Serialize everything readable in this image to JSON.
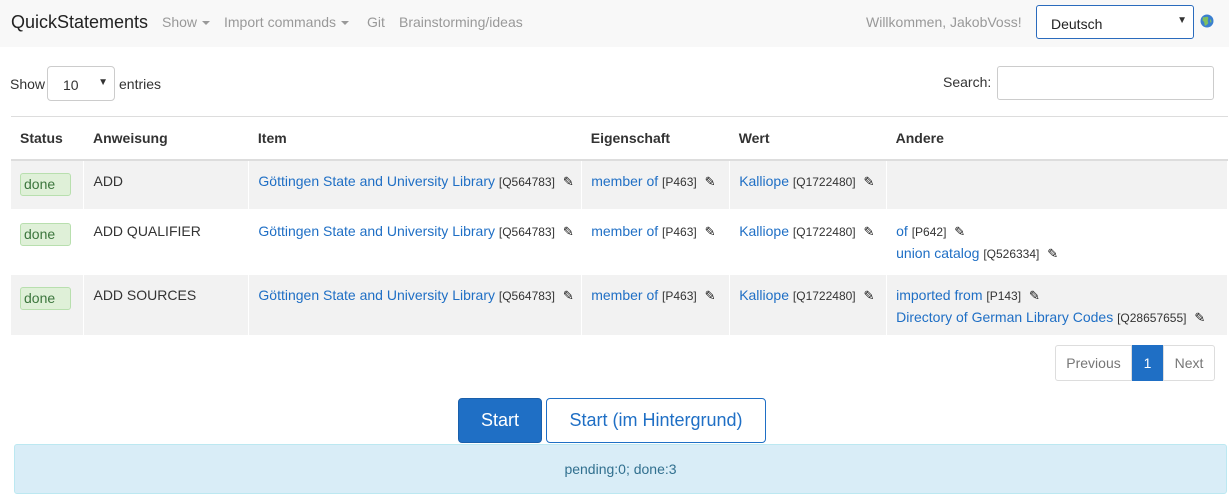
{
  "navbar": {
    "brand": "QuickStatements",
    "menu": [
      "Show",
      "Import commands",
      "Git",
      "Brainstorming/ideas"
    ],
    "welcome": "Willkommen, JakobVoss!",
    "language": "Deutsch"
  },
  "controls": {
    "show_label": "Show",
    "entries_value": "10",
    "entries_label": "entries",
    "search_label": "Search:"
  },
  "table": {
    "headers": [
      "Status",
      "Anweisung",
      "Item",
      "Eigenschaft",
      "Wert",
      "Andere"
    ],
    "rows": [
      {
        "status": "done",
        "action": "ADD",
        "item": {
          "label": "Göttingen State and University Library",
          "id": "[Q564783]"
        },
        "property": {
          "label": "member of",
          "id": "[P463]"
        },
        "value": {
          "label": "Kalliope",
          "id": "[Q1722480]"
        },
        "other": []
      },
      {
        "status": "done",
        "action": "ADD QUALIFIER",
        "item": {
          "label": "Göttingen State and University Library",
          "id": "[Q564783]"
        },
        "property": {
          "label": "member of",
          "id": "[P463]"
        },
        "value": {
          "label": "Kalliope",
          "id": "[Q1722480]"
        },
        "other": [
          {
            "label": "of",
            "id": "[P642]"
          },
          {
            "label": "union catalog",
            "id": "[Q526334]"
          }
        ]
      },
      {
        "status": "done",
        "action": "ADD SOURCES",
        "item": {
          "label": "Göttingen State and University Library",
          "id": "[Q564783]"
        },
        "property": {
          "label": "member of",
          "id": "[P463]"
        },
        "value": {
          "label": "Kalliope",
          "id": "[Q1722480]"
        },
        "other": [
          {
            "label": "imported from",
            "id": "[P143]"
          },
          {
            "label": "Directory of German Library Codes",
            "id": "[Q28657655]"
          }
        ]
      }
    ]
  },
  "pagination": {
    "previous": "Previous",
    "current": "1",
    "next": "Next"
  },
  "buttons": {
    "start": "Start",
    "start_background": "Start (im Hintergrund)"
  },
  "status_text": "pending:0; done:3",
  "icons": {
    "edit": "pencil-icon",
    "language": "globe-icon",
    "dropdown": "caret-down-icon"
  },
  "colors": {
    "link": "#1f6fc5",
    "primary": "#1f6fc5",
    "done_bg": "#dff0d8",
    "info_bg": "#d9edf7"
  }
}
